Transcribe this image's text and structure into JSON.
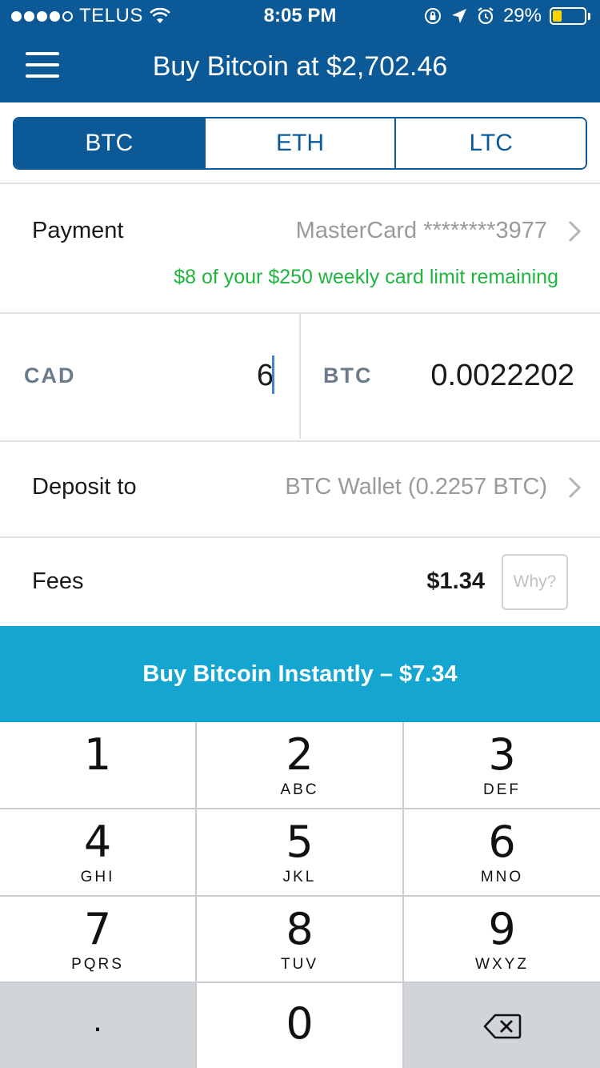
{
  "status_bar": {
    "carrier": "TELUS",
    "time": "8:05 PM",
    "battery": "29%",
    "battery_level": 0.29
  },
  "nav": {
    "title": "Buy Bitcoin at $2,702.46"
  },
  "tabs": [
    {
      "label": "BTC",
      "selected": true
    },
    {
      "label": "ETH",
      "selected": false
    },
    {
      "label": "LTC",
      "selected": false
    }
  ],
  "payment": {
    "label": "Payment",
    "value": "MasterCard ********3977",
    "limit_note": "$8 of your $250 weekly card limit remaining"
  },
  "amount": {
    "fiat_label": "CAD",
    "fiat_value": "6",
    "crypto_label": "BTC",
    "crypto_value": "0.0022202"
  },
  "deposit": {
    "label": "Deposit to",
    "value": "BTC Wallet (0.2257 BTC)"
  },
  "fees": {
    "label": "Fees",
    "value": "$1.34",
    "why_label": "Why?"
  },
  "buy_button": {
    "label": "Buy Bitcoin Instantly – $7.34"
  },
  "keypad": {
    "keys": [
      {
        "num": "1",
        "letters": ""
      },
      {
        "num": "2",
        "letters": "ABC"
      },
      {
        "num": "3",
        "letters": "DEF"
      },
      {
        "num": "4",
        "letters": "GHI"
      },
      {
        "num": "5",
        "letters": "JKL"
      },
      {
        "num": "6",
        "letters": "MNO"
      },
      {
        "num": "7",
        "letters": "PQRS"
      },
      {
        "num": "8",
        "letters": "TUV"
      },
      {
        "num": "9",
        "letters": "WXYZ"
      }
    ],
    "decimal": ".",
    "zero": "0"
  },
  "colors": {
    "brand": "#0b5a97",
    "buy_button": "#14a6d0",
    "limit_text": "#1fb53e"
  }
}
